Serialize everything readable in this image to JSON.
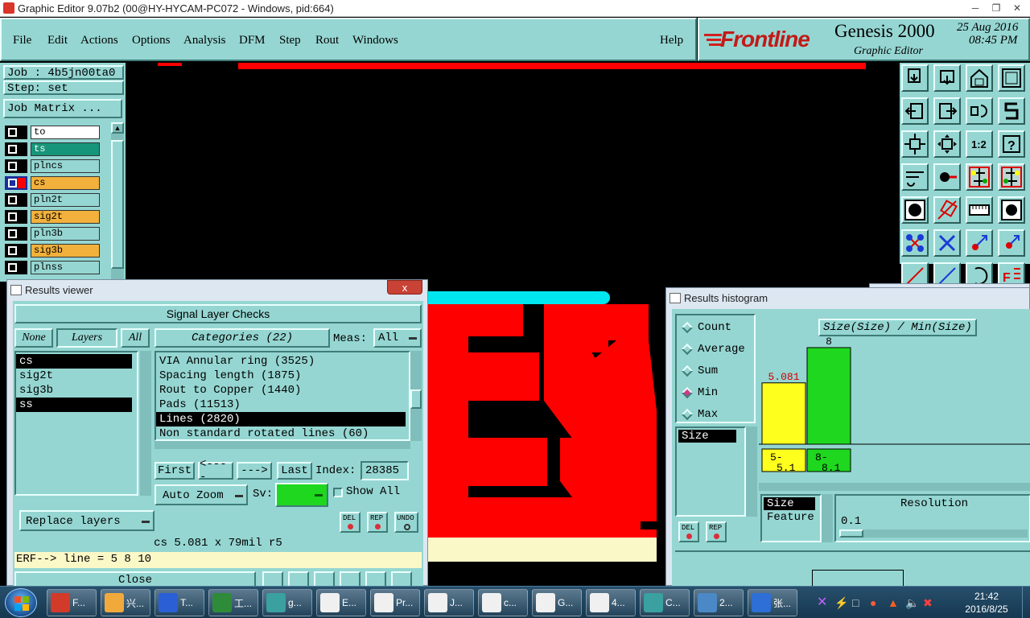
{
  "window": {
    "title": "Graphic Editor 9.07b2 (00@HY-HYCAM-PC072 - Windows, pid:664)"
  },
  "menu": [
    "File",
    "Edit",
    "Actions",
    "Options",
    "Analysis",
    "DFM",
    "Step",
    "Rout",
    "Windows"
  ],
  "help": "Help",
  "brand": {
    "logo": "Frontline",
    "product": "Genesis 2000",
    "subtitle": "Graphic Editor",
    "date": "25 Aug 2016",
    "time": "08:45 PM"
  },
  "job": {
    "job_label": "Job : 4b5jn00ta0",
    "step_label": "Step: set",
    "matrix_button": "Job Matrix ..."
  },
  "layers": [
    {
      "name": "to",
      "color": "#ffffff"
    },
    {
      "name": "ts",
      "color": "#17957a"
    },
    {
      "name": "plncs",
      "color": "#95d6d2"
    },
    {
      "name": "cs",
      "color": "#f2b13c"
    },
    {
      "name": "pln2t",
      "color": "#95d6d2"
    },
    {
      "name": "sig2t",
      "color": "#f2b13c"
    },
    {
      "name": "pln3b",
      "color": "#95d6d2"
    },
    {
      "name": "sig3b",
      "color": "#f2b13c"
    },
    {
      "name": "plnss",
      "color": "#95d6d2"
    }
  ],
  "results_viewer": {
    "title": "Results viewer",
    "close": "x",
    "section": "Signal Layer Checks",
    "none_btn": "None",
    "layers_btn": "Layers",
    "all_btn": "All",
    "layer_list": [
      "cs",
      "sig2t",
      "sig3b",
      "ss"
    ],
    "categories_label": "Categories (22)",
    "meas_label": "Meas:",
    "meas_value": "All",
    "categories": [
      "VIA Annular ring (3525)",
      "Spacing length (1875)",
      "Rout to Copper (1440)",
      "Pads (11513)",
      "Lines (2820)",
      "Non standard rotated lines (60)"
    ],
    "selected_category": "Lines (2820)",
    "nav": {
      "first": "First",
      "prev": "<----",
      "next": "--->",
      "last": "Last",
      "index_label": "Index:",
      "index_value": "28385"
    },
    "auto_zoom": "Auto Zoom",
    "sv_label": "Sv:",
    "show_all": "Show All",
    "replace_layers": "Replace layers",
    "small_buttons": [
      "DEL",
      "REP",
      "UNDO"
    ],
    "measurement": "cs 5.081 x 79mil  r5",
    "erf": "ERF--> line = 5 8 10",
    "close_btn": "Close"
  },
  "histogram": {
    "title": "Results histogram",
    "modes": [
      "Count",
      "Average",
      "Sum",
      "Min",
      "Max"
    ],
    "selected_mode": "Min",
    "chart_title": "Size(Size) / Min(Size)",
    "list": [
      "Size"
    ],
    "buttons": [
      "DEL",
      "REP"
    ],
    "size_label": "Size",
    "feature_label": "Feature",
    "resolution_label": "Resolution",
    "resolution_value": "0.1",
    "colors": {
      "bar1": "#ffff1e",
      "bar2": "#1ed71e"
    }
  },
  "chart_data": {
    "type": "bar",
    "categories": [
      "5-\n5.1",
      "8-\n8.1"
    ],
    "values": [
      5.081,
      8
    ],
    "value_labels": [
      "5.081",
      "8"
    ],
    "title": "Size(Size) / Min(Size)",
    "xlabel": "",
    "ylabel": "",
    "ylim": [
      0,
      8
    ]
  },
  "taskbar": {
    "items": [
      "F...",
      "兴...",
      "T...",
      "工...",
      "g...",
      "E...",
      "Pr...",
      "J...",
      "c...",
      "G...",
      "4...",
      "C...",
      "2...",
      "张..."
    ],
    "clock_time": "21:42",
    "clock_date": "2016/8/25"
  }
}
